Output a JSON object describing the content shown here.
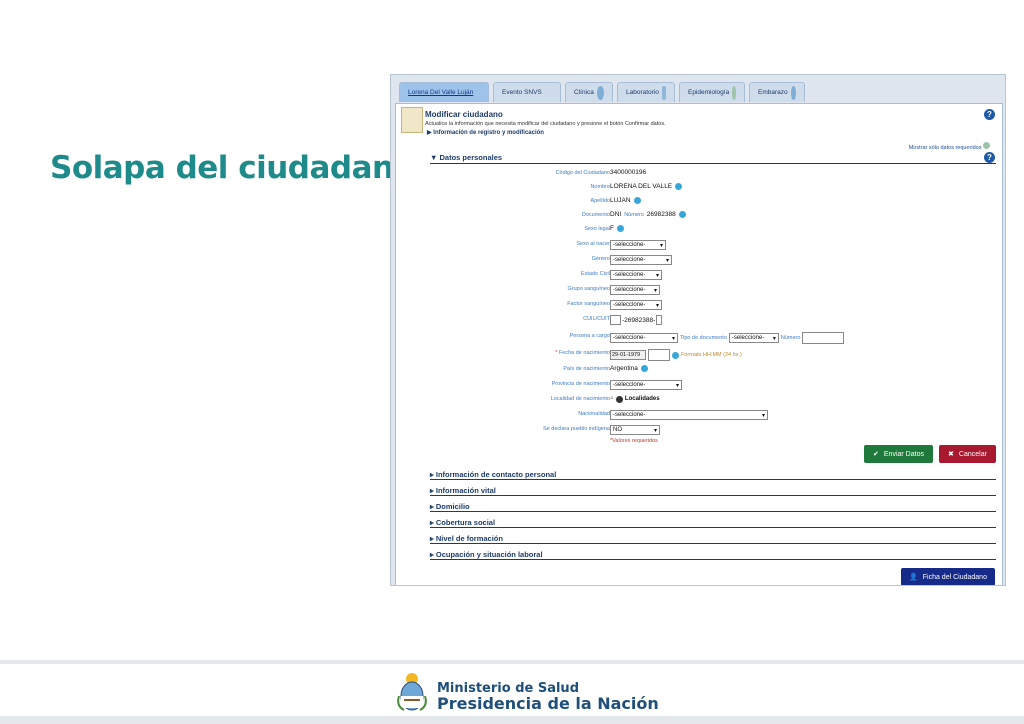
{
  "slide": {
    "title": "Solapa del ciudadano"
  },
  "tabs": [
    {
      "label": "Lorena Del Valle Luján"
    },
    {
      "label": "Evento SNVS"
    },
    {
      "label": "Clínica"
    },
    {
      "label": "Laboratorio"
    },
    {
      "label": "Epidemiología"
    },
    {
      "label": "Embarazo"
    }
  ],
  "header": {
    "title": "Modificar ciudadano",
    "subtitle": "Actualice la información que necesita modificar del ciudadano y presione el botón Confirmar datos.",
    "link": "Información de registro y modificación",
    "help": "?"
  },
  "mostrar_label": "Mostrar sólo datos requeridos",
  "datos_personales": {
    "title": "Datos personales",
    "codigo": {
      "label": "Código del Ciudadano",
      "value": "3400000196"
    },
    "nombre": {
      "label": "Nombre",
      "value": "LORENA DEL VALLE"
    },
    "apellido": {
      "label": "Apellido",
      "value": "LUJAN"
    },
    "documento": {
      "label": "Documento",
      "tipo": "DNI",
      "numero_label": "Número",
      "numero": "26982388"
    },
    "sexo_legal": {
      "label": "Sexo legal",
      "value": "F"
    },
    "sexo_al_nacer": {
      "label": "Sexo al nacer",
      "value": "-seleccione-"
    },
    "genero": {
      "label": "Género",
      "value": "-seleccione-"
    },
    "estado_civil": {
      "label": "Estado Civil",
      "value": "-seleccione-"
    },
    "grupo_sanguineo": {
      "label": "Grupo sanguíneo",
      "value": "-seleccione-"
    },
    "factor_sanguineo": {
      "label": "Factor sanguíneo",
      "value": "-seleccione-"
    },
    "cuil": {
      "label": "CUIL/CUIT",
      "value": "-26982388-"
    },
    "persona_a_cargo": {
      "label": "Persona a cargo",
      "value": "-seleccione-",
      "tipo_label": "Tipo de documento",
      "tipo_value": "-seleccione-",
      "numero_label": "Número"
    },
    "fecha_nacimiento": {
      "req": "*",
      "label": "Fecha de nacimiento",
      "value": "29-01-1979",
      "formato": "Formato HH:MM (24 hs.)"
    },
    "pais": {
      "label": "País de nacimiento",
      "value": "Argentina"
    },
    "provincia": {
      "label": "Provincia de nacimiento",
      "value": "-seleccione-"
    },
    "localidad": {
      "label": "Localidad de nacimiento",
      "value": "Localidades"
    },
    "nacionalidad": {
      "label": "Nacionalidad",
      "value": "-seleccione-"
    },
    "pueblo_indigena": {
      "label": "Se declara pueblo indígena",
      "value": "NO"
    },
    "valores_requeridos": "*Valores requeridos"
  },
  "buttons": {
    "enviar": "Enviar Datos",
    "cancelar": "Cancelar",
    "ficha": "Ficha del Ciudadano"
  },
  "sections": [
    "Información de contacto personal",
    "Información vital",
    "Domicilio",
    "Cobertura social",
    "Nivel de formación",
    "Ocupación y situación laboral"
  ],
  "footer": {
    "ministerio": "Ministerio de Salud",
    "presidencia": "Presidencia de la Nación"
  },
  "colors": {
    "title": "#1f8a8a",
    "enviar": "#1e7a3a",
    "cancelar": "#a8182e",
    "ficha": "#162a8a",
    "link": "#1e3c6b"
  }
}
